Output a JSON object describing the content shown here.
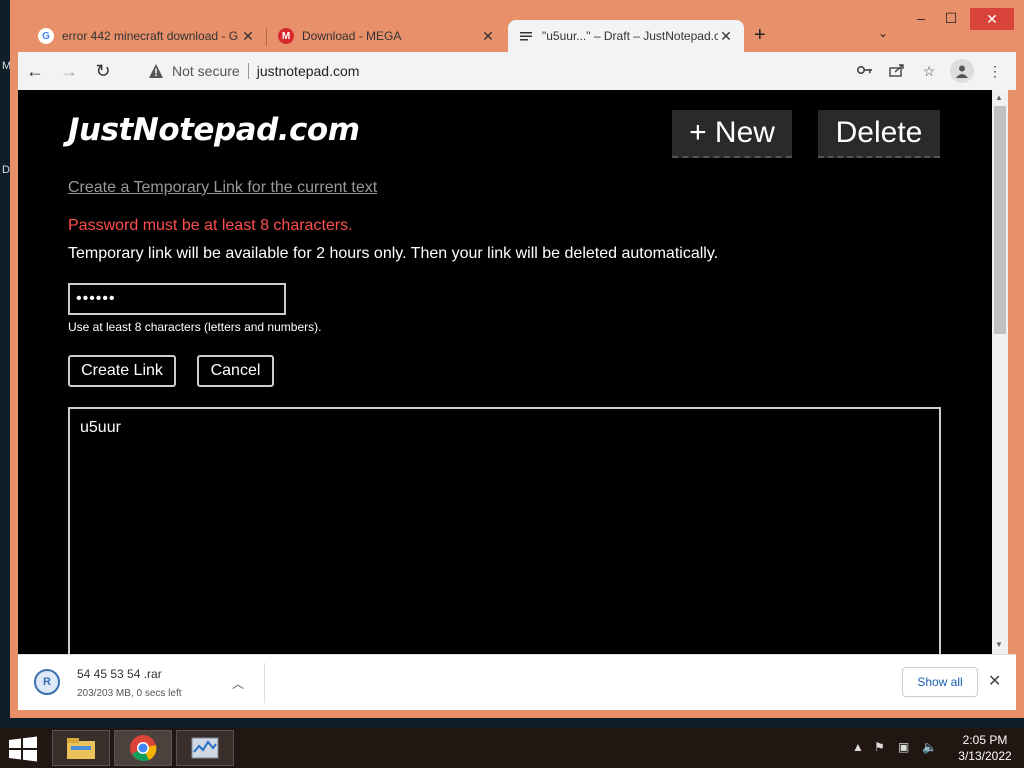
{
  "desktop": {
    "chars": [
      "M",
      "D"
    ]
  },
  "browser": {
    "tabs": [
      {
        "label": "error 442 minecraft download - G",
        "close": "✕"
      },
      {
        "label": "Download - MEGA",
        "close": "✕"
      },
      {
        "label": "\"u5uur...\" – Draft – JustNotepad.c",
        "close": "✕"
      }
    ],
    "new_tab": "+",
    "tab_list": "⌄",
    "window_controls": {
      "minimize": "–",
      "maximize": "☐",
      "close": "✕"
    },
    "security_label": "Not secure",
    "url": "justnotepad.com"
  },
  "page": {
    "logo": "JustNotepad.com",
    "new_button": "+ New",
    "delete_button": "Delete",
    "temp_link": "Create a Temporary Link for the current text",
    "error": "Password must be at least 8 characters.",
    "info": "Temporary link will be available for 2 hours only. Then your link will be deleted automatically.",
    "password_value": "••••••",
    "hint": "Use at least 8 characters (letters and numbers).",
    "create_link": "Create Link",
    "cancel": "Cancel",
    "note_text": "u5uur"
  },
  "download": {
    "filename": "54 45 53 54 .rar",
    "status": "203/203 MB, 0 secs left",
    "show_all": "Show all"
  },
  "taskbar": {
    "time": "2:05 PM",
    "date": "3/13/2022"
  },
  "colors": {
    "frame": "#e8906a",
    "error": "#ff4d4d",
    "link": "#999999"
  }
}
